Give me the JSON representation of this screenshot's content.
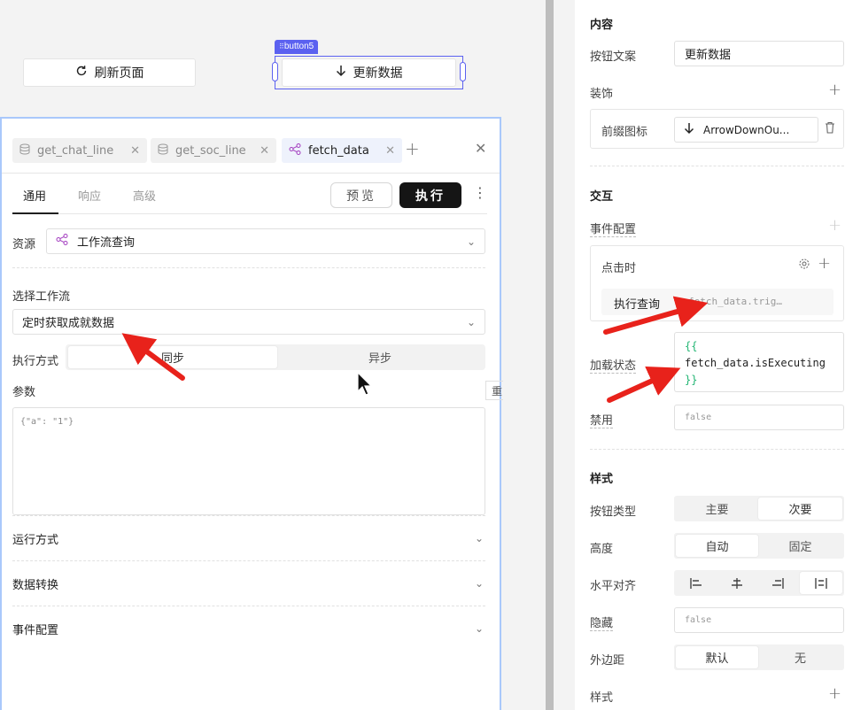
{
  "canvas": {
    "refresh_button": "刷新页面",
    "update_button": "更新数据",
    "selection_tag": "button5"
  },
  "query_panel": {
    "tabs": [
      {
        "label": "get_chat_line",
        "icon": "database-icon"
      },
      {
        "label": "get_soc_line",
        "icon": "database-icon"
      },
      {
        "label": "fetch_data",
        "icon": "workflow-icon",
        "active": true
      }
    ],
    "subtabs": [
      "通用",
      "响应",
      "高级"
    ],
    "preview": "预览",
    "run": "执行",
    "resource_label": "资源",
    "resource_value": "工作流查询",
    "workflow_label": "选择工作流",
    "workflow_value": "定时获取成就数据",
    "exec_mode_label": "执行方式",
    "exec_modes": [
      "同步",
      "异步"
    ],
    "params_label": "参数",
    "params_placeholder": "{\"a\": \"1\"}",
    "cut_label": "重",
    "sections": [
      "运行方式",
      "数据转换",
      "事件配置"
    ]
  },
  "props": {
    "content_title": "内容",
    "button_text_label": "按钮文案",
    "button_text_value": "更新数据",
    "decoration_label": "装饰",
    "prefix_icon_label": "前缀图标",
    "prefix_icon_value": "ArrowDownOu...",
    "interaction_title": "交互",
    "event_config_label": "事件配置",
    "on_click_label": "点击时",
    "exec_query_label": "执行查询",
    "exec_query_value": "fetch_data.trig…",
    "loading_label": "加载状态",
    "loading_open": "{{",
    "loading_expr": "fetch_data.isExecuting",
    "loading_close": "}}",
    "disabled_label": "禁用",
    "disabled_value": "false",
    "style_title": "样式",
    "button_type_label": "按钮类型",
    "button_types": [
      "主要",
      "次要"
    ],
    "height_label": "高度",
    "heights": [
      "自动",
      "固定"
    ],
    "halign_label": "水平对齐",
    "hidden_label": "隐藏",
    "hidden_value": "false",
    "margin_label": "外边距",
    "margins": [
      "默认",
      "无"
    ],
    "style_label": "样式"
  },
  "colors": {
    "accent": "#5b61f0",
    "arrow_red": "#e8221b",
    "run_button": "#151515",
    "code_brace": "#22b573"
  }
}
